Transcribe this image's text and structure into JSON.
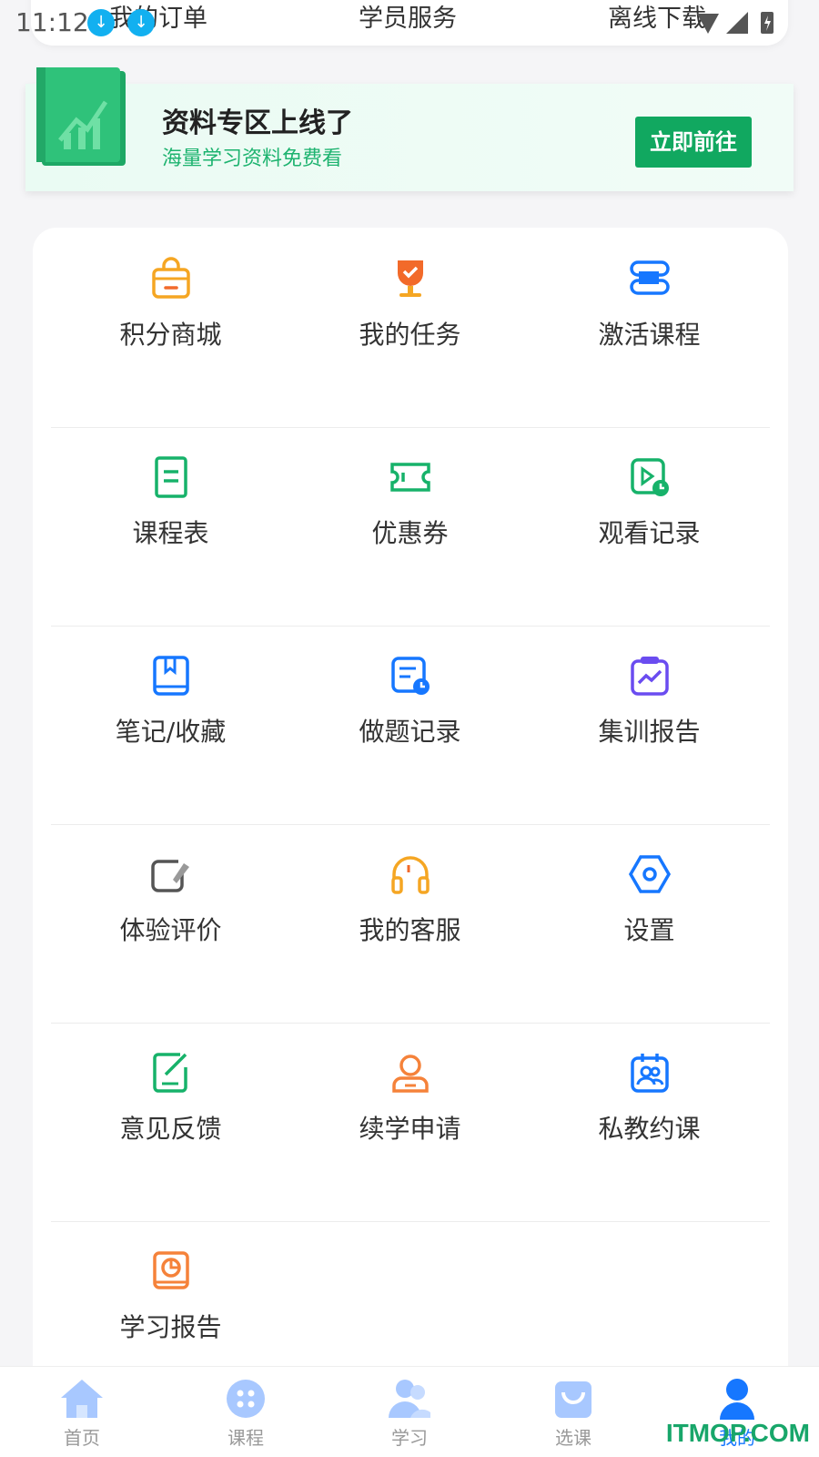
{
  "status_bar": {
    "time": "11:12"
  },
  "top_tabs": [
    "我的订单",
    "学员服务",
    "离线下载"
  ],
  "banner": {
    "title": "资料专区上线了",
    "subtitle": "海量学习资料免费看",
    "button": "立即前往"
  },
  "grid": [
    {
      "label": "积分商城",
      "icon": "shopping-bag-icon",
      "color": "#f5a623"
    },
    {
      "label": "我的任务",
      "icon": "trophy-icon",
      "color": "#f26a2a"
    },
    {
      "label": "激活课程",
      "icon": "stack-icon",
      "color": "#1677ff"
    },
    {
      "label": "课程表",
      "icon": "document-icon",
      "color": "#17b26a"
    },
    {
      "label": "优惠券",
      "icon": "ticket-icon",
      "color": "#17b26a"
    },
    {
      "label": "观看记录",
      "icon": "video-history-icon",
      "color": "#17b26a"
    },
    {
      "label": "笔记/收藏",
      "icon": "bookmark-book-icon",
      "color": "#1677ff"
    },
    {
      "label": "做题记录",
      "icon": "quiz-history-icon",
      "color": "#1677ff"
    },
    {
      "label": "集训报告",
      "icon": "chart-report-icon",
      "color": "#6a4cf0"
    },
    {
      "label": "体验评价",
      "icon": "edit-review-icon",
      "color": "#555555"
    },
    {
      "label": "我的客服",
      "icon": "headset-icon",
      "color": "#f5a623"
    },
    {
      "label": "设置",
      "icon": "settings-hexagon-icon",
      "color": "#1677ff"
    },
    {
      "label": "意见反馈",
      "icon": "feedback-edit-icon",
      "color": "#17b26a"
    },
    {
      "label": "续学申请",
      "icon": "user-apply-icon",
      "color": "#f5823a"
    },
    {
      "label": "私教约课",
      "icon": "tutor-calendar-icon",
      "color": "#1677ff"
    },
    {
      "label": "学习报告",
      "icon": "study-report-icon",
      "color": "#f5823a"
    }
  ],
  "bottom_nav": [
    {
      "label": "首页",
      "icon": "home-icon"
    },
    {
      "label": "课程",
      "icon": "course-icon"
    },
    {
      "label": "学习",
      "icon": "study-icon"
    },
    {
      "label": "选课",
      "icon": "select-course-icon"
    },
    {
      "label": "我的",
      "icon": "profile-icon",
      "active": true
    }
  ],
  "watermark": "ITMOP.COM"
}
